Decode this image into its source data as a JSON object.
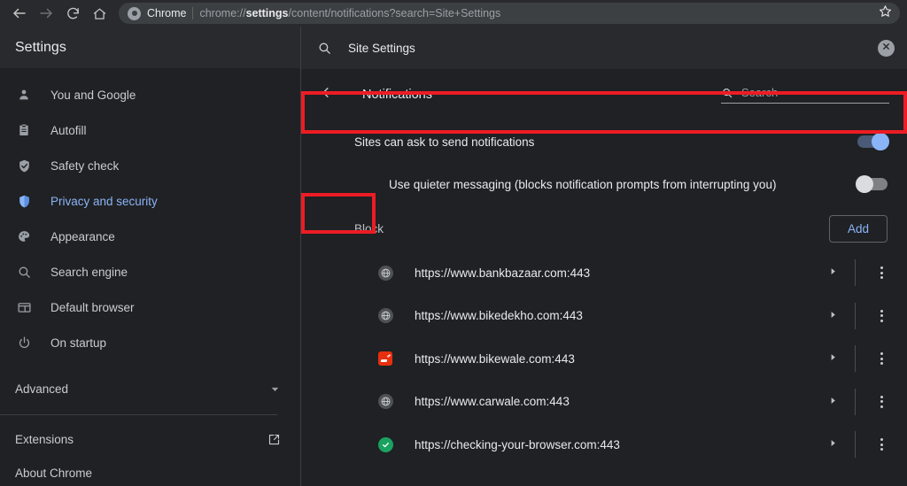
{
  "browser": {
    "back_icon": "back-arrow-icon",
    "forward_icon": "forward-arrow-icon",
    "reload_icon": "reload-icon",
    "home_icon": "home-icon",
    "brand": "Chrome",
    "url_prefix": "chrome://",
    "url_bold": "settings",
    "url_suffix": "/content/notifications?search=Site+Settings",
    "url_full": "chrome://settings/content/notifications?search=Site+Settings",
    "bookmark_icon": "star-icon"
  },
  "sidebar": {
    "title": "Settings",
    "items": [
      {
        "label": "You and Google",
        "icon": "person-icon",
        "active": false
      },
      {
        "label": "Autofill",
        "icon": "clipboard-icon",
        "active": false
      },
      {
        "label": "Safety check",
        "icon": "shield-check-icon",
        "active": false
      },
      {
        "label": "Privacy and security",
        "icon": "shield-icon",
        "active": true
      },
      {
        "label": "Appearance",
        "icon": "palette-icon",
        "active": false
      },
      {
        "label": "Search engine",
        "icon": "search-icon",
        "active": false
      },
      {
        "label": "Default browser",
        "icon": "browser-window-icon",
        "active": false
      },
      {
        "label": "On startup",
        "icon": "power-icon",
        "active": false
      }
    ],
    "advanced": {
      "label": "Advanced",
      "icon": "chevron-down-icon"
    },
    "extensions": {
      "label": "Extensions",
      "icon": "external-link-icon"
    },
    "about": {
      "label": "About Chrome"
    }
  },
  "top_search": {
    "icon": "search-icon",
    "value": "Site Settings",
    "clear_icon": "close-circle-icon"
  },
  "page": {
    "back_icon": "back-arrow-icon",
    "title": "Notifications",
    "search": {
      "icon": "search-icon",
      "placeholder": "Search",
      "value": ""
    }
  },
  "settings": [
    {
      "label": "Sites can ask to send notifications",
      "toggle": "on",
      "toggle_name": "sites-can-ask-toggle",
      "highlighted": true
    },
    {
      "label": "Use quieter messaging (blocks notification prompts from interrupting you)",
      "toggle": "off",
      "toggle_name": "quieter-messaging-toggle",
      "highlighted": false
    }
  ],
  "block_section": {
    "label": "Block",
    "highlighted": true,
    "add_label": "Add"
  },
  "sites": [
    {
      "url": "https://www.bankbazaar.com:443",
      "favicon": "globe-icon"
    },
    {
      "url": "https://www.bikedekho.com:443",
      "favicon": "globe-icon"
    },
    {
      "url": "https://www.bikewale.com:443",
      "favicon": "bikewale-favicon"
    },
    {
      "url": "https://www.carwale.com:443",
      "favicon": "globe-icon"
    },
    {
      "url": "https://checking-your-browser.com:443",
      "favicon": "green-check-favicon"
    }
  ],
  "row_controls": {
    "expand_icon": "triangle-right-icon",
    "menu_icon": "more-vertical-icon"
  },
  "colors": {
    "accent": "#8ab4f8",
    "background": "#202124",
    "surface": "#292a2d",
    "annotation": "#ed1c24",
    "toggle_on_track": "#4a5a77",
    "toggle_off_track": "#7d8084"
  }
}
